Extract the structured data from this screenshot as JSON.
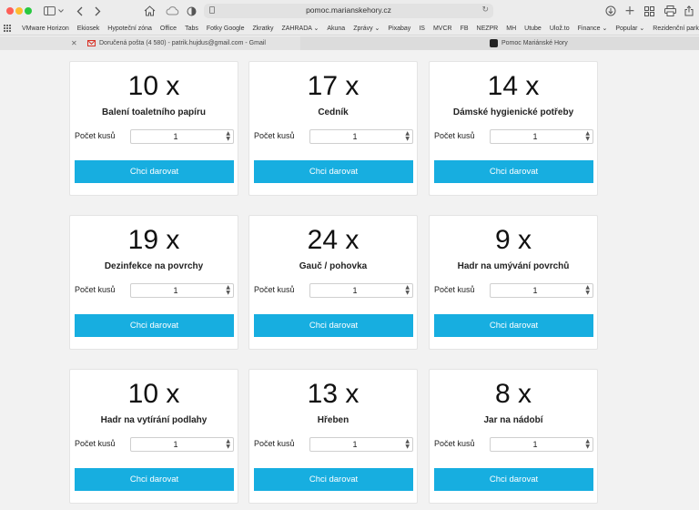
{
  "browser": {
    "url": "pomoc.marianskehory.cz"
  },
  "bookmarks": [
    "VMware Horizon",
    "Ekiosek",
    "Hypoteční zóna",
    "Office",
    "Tabs",
    "Fotky Google",
    "Zkratky",
    "ZAHRADA ⌄",
    "Akuna",
    "Zprávy ⌄",
    "Pixabay",
    "IS",
    "MVCR",
    "FB",
    "NEZPR",
    "MH",
    "Utube",
    "Ulož.to",
    "Finance ⌄",
    "Popular ⌄",
    "Rezidenční parkování ⌄"
  ],
  "tabs": [
    {
      "label": "Doručená pošta (4 580) - patrik.hujdus@gmail.com - Gmail"
    },
    {
      "label": "Pomoc Mariánské Hory"
    }
  ],
  "common": {
    "count_label": "Počet kusů",
    "donate_label": "Chci darovat"
  },
  "items": [
    {
      "qty": "10 x",
      "name": "Balení toaletního papíru",
      "value": "1"
    },
    {
      "qty": "17 x",
      "name": "Cedník",
      "value": "1"
    },
    {
      "qty": "14 x",
      "name": "Dámské hygienické potřeby",
      "value": "1"
    },
    {
      "qty": "19 x",
      "name": "Dezinfekce na povrchy",
      "value": "1"
    },
    {
      "qty": "24 x",
      "name": "Gauč / pohovka",
      "value": "1"
    },
    {
      "qty": "9 x",
      "name": "Hadr na umývání povrchů",
      "value": "1"
    },
    {
      "qty": "10 x",
      "name": "Hadr na vytírání podlahy",
      "value": "1"
    },
    {
      "qty": "13 x",
      "name": "Hřeben",
      "value": "1"
    },
    {
      "qty": "8 x",
      "name": "Jar na nádobí",
      "value": "1"
    }
  ]
}
